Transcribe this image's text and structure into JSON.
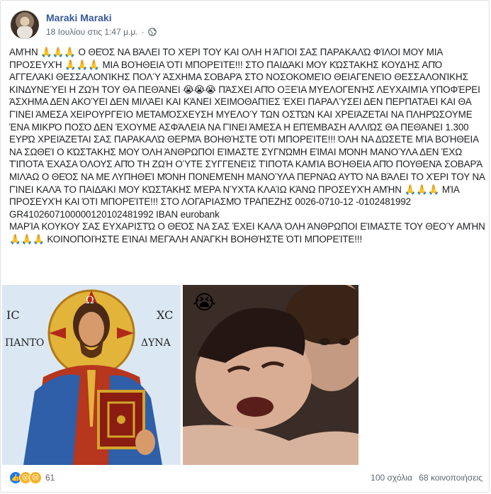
{
  "post": {
    "author": "Maraki Maraki",
    "date": "18 Ιουλίου στις 1:47 μ.μ.",
    "separator": "·",
    "privacy_icon": "globe-icon",
    "paragraphs": [
      "ΑΜΉΝ 🙏🙏🙏 Ο ΘΕΌΣ ΝΑ ΒΆΛΕΙ ΤΟ ΧΈΡΙ ΤΟΥ ΚΑΙ ΟΛΗ Η ΆΓΙΟΙ ΣΑΣ ΠΑΡΑΚΑΛΏ ΦΊΛΟΙ ΜΟΥ ΜΙΑ ΠΡΟΣΕΥΧΉ 🙏🙏🙏 ΜΙΑ ΒΟΉΘΕΙΑ ΌΤΙ ΜΠΟΡΕΊΤΕ!!! ΣΤΟ ΠΑΙΔΆΚΙ ΜΟΥ ΚΏΣΤΑΚΗΣ ΚΟΥΔΉΣ ΑΠΌ ΑΓΓΕΛΆΚΙ ΘΕΣΣΑΛΟΝΊΚΗΣ ΠΟΛΎ ΆΣΧΗΜΑ ΣΟΒΑΡΆ ΣΤΟ ΝΟΣΟΚΟΜΕΊΟ ΘΕΙΑΓΕΝΕΊΟ ΘΕΣΣΑΛΟΝΊΚΗΣ ΚΙΝΔΥΝΕΎΕΙ Η ΖΩΉ ΤΟΥ ΘΑ ΠΕΘΆΝΕΙ 😭😭😭 ΠΆΣΧΕΙ ΑΠΌ ΟΞΕΊΑ ΜΥΕΛΟΓΕΝΉΣ ΛΕΥΧΑΙΜΊΑ ΥΠΟΦΈΡΕΙ ΆΣΧΗΜΑ ΔΕΝ ΑΚΟΎΕΙ ΔΕΝ ΜΙΛΆΕΙ ΚΑΙ ΚΆΝΕΙ ΧΕΙΜΟΘΑΠΊΕΣ ΈΧΕΙ ΠΑΡΑΛΎΣΕΙ ΔΕΝ ΠΕΡΠΑΤΆΕΙ ΚΑΙ ΘΑ ΓΊΝΕΙ ΆΜΕΣΑ ΧΕΙΡΟΥΡΓΕΊΟ ΜΕΤΑΜΌΣΧΕΥΣΗ ΜΥΕΛΟΎ ΤΩΝ ΟΣΤΏΝ ΚΑΙ ΧΡΕΙΆΖΕΤΑΙ ΝΑ ΠΛΗΡΏΣΟΥΜΕ ΈΝΑ ΜΙΚΡΌ ΠΟΣΌ ΔΕΝ ΈΧΟΥΜΕ ΑΣΦΆΛΕΙΑ ΝΑ ΓΊΝΕΙ ΆΜΕΣΑ Η ΕΠΈΜΒΑΣΗ ΑΛΛΙΏΣ ΘΑ ΠΕΘΆΝΕΙ 1.300 ΕΥΡΏ ΧΡΕΙΆΖΕΤΑΙ ΣΑΣ ΠΑΡΑΚΑΛΏ ΘΕΡΜΆ ΒΟΗΘΉΣΤΕ ΌΤΙ ΜΠΟΡΕΊΤΕ!!! ΌΛΗ ΝΑ ΔΏΣΕΤΕ ΜΊΑ ΒΟΉΘΕΙΑ ΝΑ ΣΩΘΕΊ Ο ΚΏΣΤΑΚΗΣ ΜΟΥ ΌΛΗ ΆΝΘΡΩΠΟΙ ΕΊΜΑΣΤΕ ΣΥΓΝΏΜΗ ΕΊΜΑΙ ΜΌΝΗ ΜΑΝΟΎΛΑ ΔΕΝ ΈΧΩ ΤΊΠΟΤΑ ΈΧΑΣΑ ΌΛΟΥΣ ΑΠΌ ΤΗ ΖΩΉ ΟΎΤΕ ΣΥΓΓΕΝΕΊΣ ΤΊΠΟΤΑ ΚΑΜΊΑ ΒΟΉΘΕΙΑ ΑΠΌ ΠΟΥΘΕΝΆ ΣΟΒΑΡΆ ΜΙΛΆΩ Ο ΘΕΌΣ ΝΑ ΜΕ ΛΥΠΗΘΕΊ ΜΌΝΗ ΠΟΝΕΜΈΝΗ ΜΑΝΟΎΛΑ ΠΕΡΝΆΩ ΑΥΤΌ ΝΑ ΒΆΛΕΙ ΤΟ ΧΈΡΙ ΤΟΥ ΝΑ ΓΊΝΕΙ ΚΑΛΆ ΤΟ ΠΑΙΔΆΚΙ ΜΟΥ ΚΏΣΤΑΚΗΣ ΜΈΡΑ ΝΎΧΤΑ ΚΛΑΊΩ ΚΆΝΩ ΠΡΟΣΕΥΧΉ ΑΜΉΝ 🙏🙏🙏 ΜΊΑ ΠΡΟΣΕΥΧΉ ΚΑΙ ΌΤΙ ΜΠΟΡΕΊΤΕ!!! ΣΤΟ ΛΟΓΑΡΙΑΣΜΌ ΤΡΑΠΕΖΗΣ 0026-0710-12 -0102481992 GR4102607100000120102481992 IBAN eurobank",
      "ΜΑΡΊΑ ΚΟΥΚΟΥ ΣΑΣ ΕΥΧΑΡΙΣΤΏ Ο ΘΕΌΣ ΝΑ ΣΑΣ ΈΧΕΙ ΚΑΛΆ ΌΛΗ ΆΝΘΡΩΠΟΙ ΕΊΜΑΣΤΕ ΤΟΥ ΘΕΟΎ ΑΜΉΝ 🙏🙏🙏 ΚΟΙΝΟΠΟΙΉΣΤΕ ΕΊΝΑΙ ΜΕΓΆΛΗ ΑΝΆΓΚΗ ΒΟΗΘΉΣΤΕ ΌΤΙ ΜΠΟΡΕΊΤΕ!!!"
    ],
    "image_icon_text": {
      "ic": "ΙC",
      "xc": "XC",
      "panto": "ΠΑΝΤΟ",
      "dyna": "ΔΥΝΑ",
      "halo": "Ω"
    },
    "photo2_emoji": "😭",
    "reactions": {
      "icons": [
        "like-icon",
        "wow-icon",
        "sad-icon"
      ],
      "count": "61"
    },
    "comments": "100 σχόλια",
    "shares": "68 κοινοποιήσεις"
  }
}
